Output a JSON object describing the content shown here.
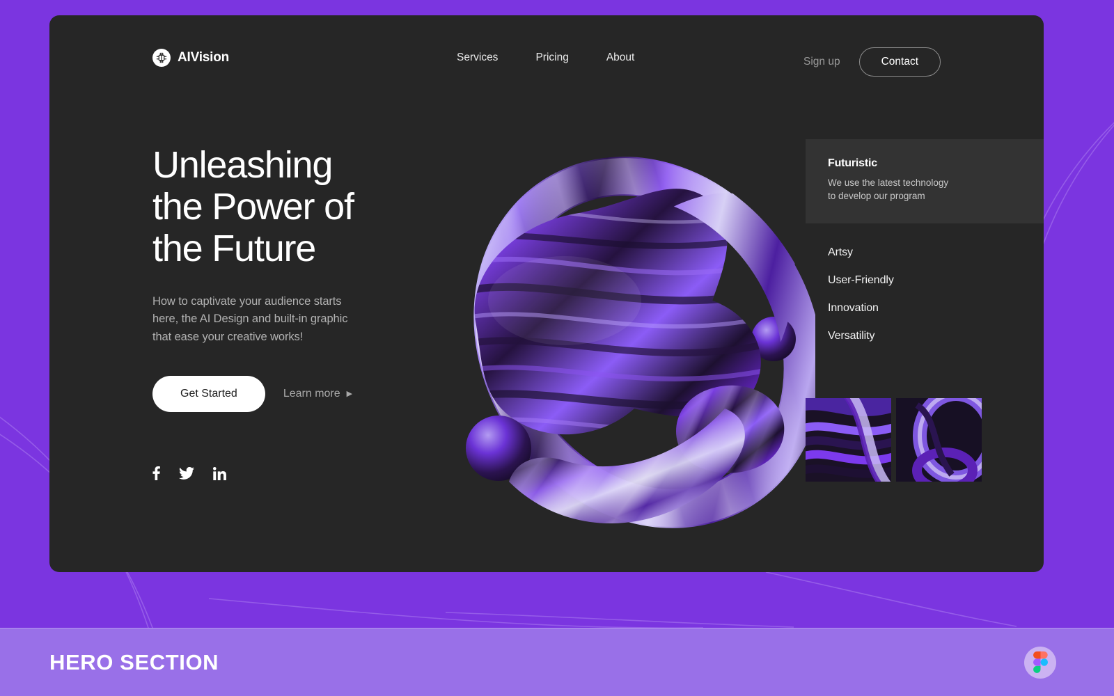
{
  "brand": {
    "name": "AIVision",
    "logo_icon": "brain-chip-icon"
  },
  "nav": {
    "items": [
      {
        "label": "Services"
      },
      {
        "label": "Pricing"
      },
      {
        "label": "About"
      }
    ]
  },
  "header_actions": {
    "signup_label": "Sign up",
    "contact_label": "Contact"
  },
  "hero": {
    "title": "Unleashing\nthe Power of\nthe Future",
    "subtitle": "How to captivate your audience starts\nhere, the AI Design and built-in graphic\nthat ease your creative works!",
    "primary_cta": "Get Started",
    "secondary_cta": "Learn more",
    "secondary_cta_icon": "chevron-right-icon"
  },
  "social": {
    "items": [
      {
        "name": "facebook-icon",
        "label": "Facebook"
      },
      {
        "name": "twitter-icon",
        "label": "Twitter"
      },
      {
        "name": "linkedin-icon",
        "label": "LinkedIn"
      }
    ]
  },
  "features": {
    "active": {
      "title": "Futuristic",
      "description": "We use the latest technology\nto develop our program"
    },
    "items": [
      {
        "label": "Artsy"
      },
      {
        "label": "User-Friendly"
      },
      {
        "label": "Innovation"
      },
      {
        "label": "Versatility"
      }
    ]
  },
  "thumbnails": {
    "items": [
      {
        "name": "abstract-3d-thumbnail-1"
      },
      {
        "name": "abstract-3d-thumbnail-2"
      }
    ]
  },
  "artwork": {
    "name": "abstract-3d-purple-render"
  },
  "caption": {
    "title": "HERO SECTION",
    "badge_icon": "figma-logo-icon"
  },
  "colors": {
    "page_background": "#7B35E0",
    "card_background": "#262626",
    "feature_card_background": "#333333",
    "caption_bar": "#9970E8",
    "accent_white": "#FFFFFF",
    "muted_text": "#B2B2B2"
  }
}
